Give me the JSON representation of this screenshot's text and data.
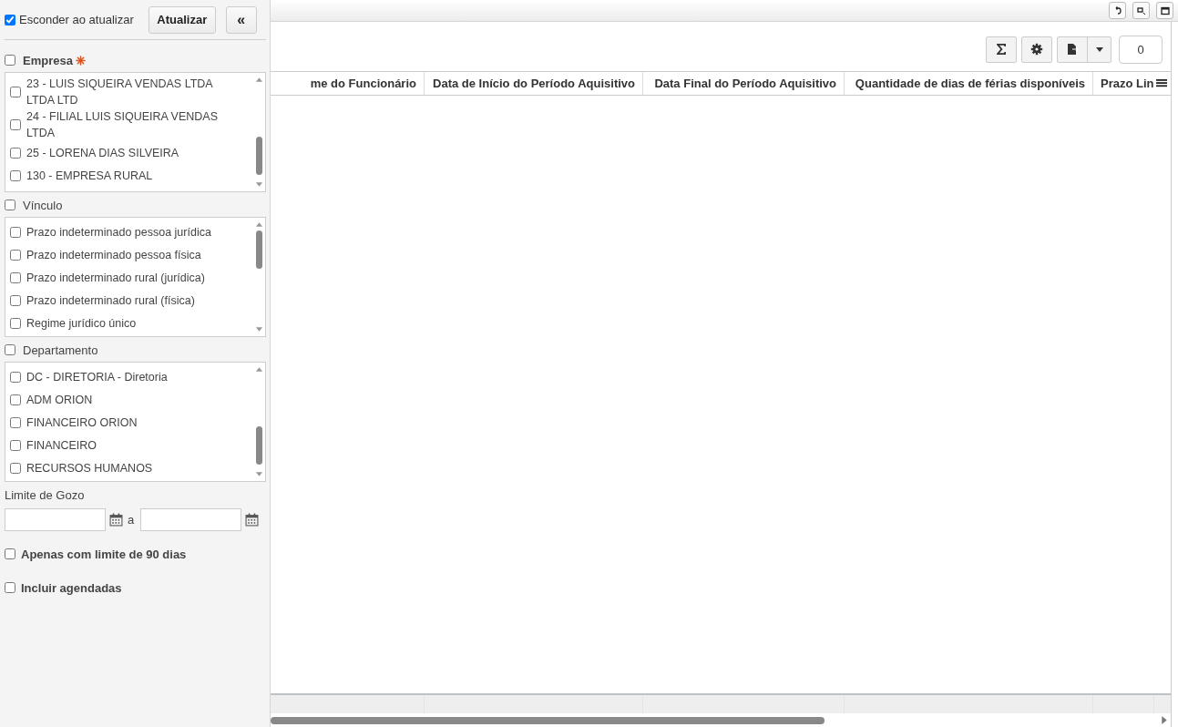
{
  "sidebar": {
    "hide_on_refresh": {
      "label": "Esconder ao atualizar",
      "checked": true
    },
    "refresh_button": "Atualizar",
    "collapse_button": "«",
    "filters": [
      {
        "label": "Empresa",
        "required": true,
        "checked": false,
        "items": [
          {
            "label": "23 - LUIS SIQUEIRA VENDAS LTDA LTDA LTD",
            "checked": false
          },
          {
            "label": "24 - FILIAL LUIS SIQUEIRA VENDAS LTDA",
            "checked": false
          },
          {
            "label": "25 - LORENA DIAS SILVEIRA",
            "checked": false
          },
          {
            "label": "130 - EMPRESA RURAL",
            "checked": false
          }
        ]
      },
      {
        "label": "Vínculo",
        "required": false,
        "checked": false,
        "items": [
          {
            "label": "Prazo indeterminado pessoa jurídica",
            "checked": false
          },
          {
            "label": "Prazo indeterminado pessoa física",
            "checked": false
          },
          {
            "label": "Prazo indeterminado rural (jurídica)",
            "checked": false
          },
          {
            "label": "Prazo indeterminado rural (física)",
            "checked": false
          },
          {
            "label": "Regime jurídico único",
            "checked": false
          }
        ]
      },
      {
        "label": "Departamento",
        "required": false,
        "checked": false,
        "items": [
          {
            "label": "DC - DIRETORIA - Diretoria",
            "checked": false
          },
          {
            "label": "ADM ORION",
            "checked": false
          },
          {
            "label": "FINANCEIRO ORION",
            "checked": false
          },
          {
            "label": "FINANCEIRO",
            "checked": false
          },
          {
            "label": "RECURSOS HUMANOS",
            "checked": false
          }
        ]
      }
    ],
    "date_range": {
      "label": "Limite de Gozo",
      "separator": "a"
    },
    "options": [
      {
        "label": "Apenas com limite de 90 dias",
        "checked": false
      },
      {
        "label": "Incluir agendadas",
        "checked": false
      }
    ]
  },
  "grid": {
    "record_count": "0",
    "columns": [
      "me do Funcionário",
      "Data de Início do Período Aquisitivo",
      "Data Final do Período Aquisitivo",
      "Quantidade de dias de férias disponíveis",
      "Prazo Lin"
    ]
  }
}
